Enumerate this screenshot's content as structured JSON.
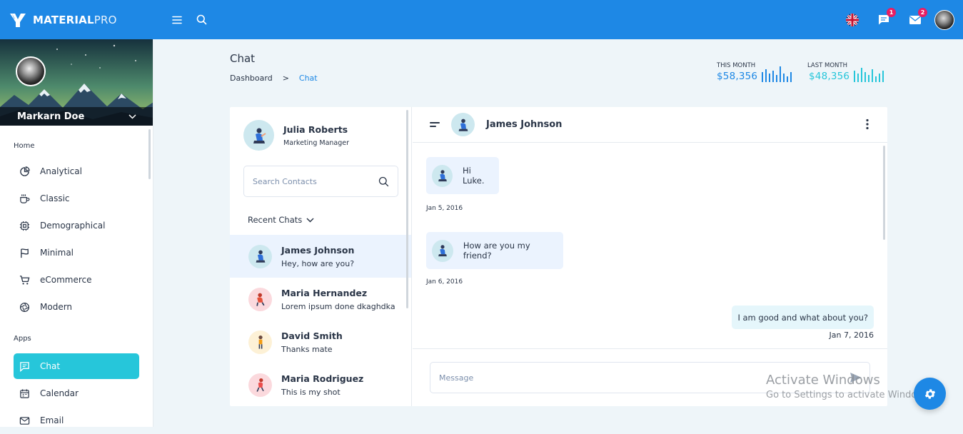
{
  "brand": {
    "bold": "MATERIAL",
    "light": "PRO"
  },
  "topbar": {
    "messages_badge": "1",
    "mail_badge": "2"
  },
  "sidebar": {
    "user_name": "Markarn Doe",
    "sections": [
      {
        "title": "Home"
      },
      {
        "title": "Apps"
      }
    ],
    "home_items": [
      {
        "label": "Analytical",
        "icon": "pie-chart-icon"
      },
      {
        "label": "Classic",
        "icon": "coffee-icon"
      },
      {
        "label": "Demographical",
        "icon": "cpu-icon"
      },
      {
        "label": "Minimal",
        "icon": "flag-icon"
      },
      {
        "label": "eCommerce",
        "icon": "cart-icon"
      },
      {
        "label": "Modern",
        "icon": "aperture-icon"
      }
    ],
    "app_items": [
      {
        "label": "Chat",
        "icon": "message-icon",
        "active": true
      },
      {
        "label": "Calendar",
        "icon": "calendar-icon"
      },
      {
        "label": "Email",
        "icon": "mail-icon"
      }
    ]
  },
  "page": {
    "title": "Chat",
    "breadcrumb": [
      "Dashboard",
      ">",
      "Chat"
    ]
  },
  "stats": [
    {
      "label": "THIS MONTH",
      "value": "$58,356",
      "color": "#1e88e5"
    },
    {
      "label": "LAST MONTH",
      "value": "$48,356",
      "color": "#26c6da"
    }
  ],
  "contacts": {
    "me": {
      "name": "Julia Roberts",
      "role": "Marketing Manager"
    },
    "search_placeholder": "Search Contacts",
    "recent_label": "Recent Chats",
    "list": [
      {
        "name": "James Johnson",
        "message": "Hey, how are you?",
        "selected": true
      },
      {
        "name": "Maria Hernandez",
        "message": "Lorem ipsum done dkaghdka"
      },
      {
        "name": "David Smith",
        "message": "Thanks mate"
      },
      {
        "name": "Maria Rodriguez",
        "message": "This is my shot"
      }
    ]
  },
  "conversation": {
    "with": "James Johnson",
    "messages": [
      {
        "text": "Hi Luke.",
        "date": "Jan 5, 2016"
      },
      {
        "text": "How are you my friend?",
        "date": "Jan 6, 2016"
      }
    ],
    "reply": {
      "text": "I am good and what about you?",
      "date": "Jan 7, 2016"
    },
    "compose_placeholder": "Message"
  },
  "watermark": {
    "line1": "Activate Windows",
    "line2": "Go to Settings to activate Windows."
  },
  "colors": {
    "primary": "#1e88e5",
    "accent": "#26c6da",
    "badge": "#e91e63"
  }
}
